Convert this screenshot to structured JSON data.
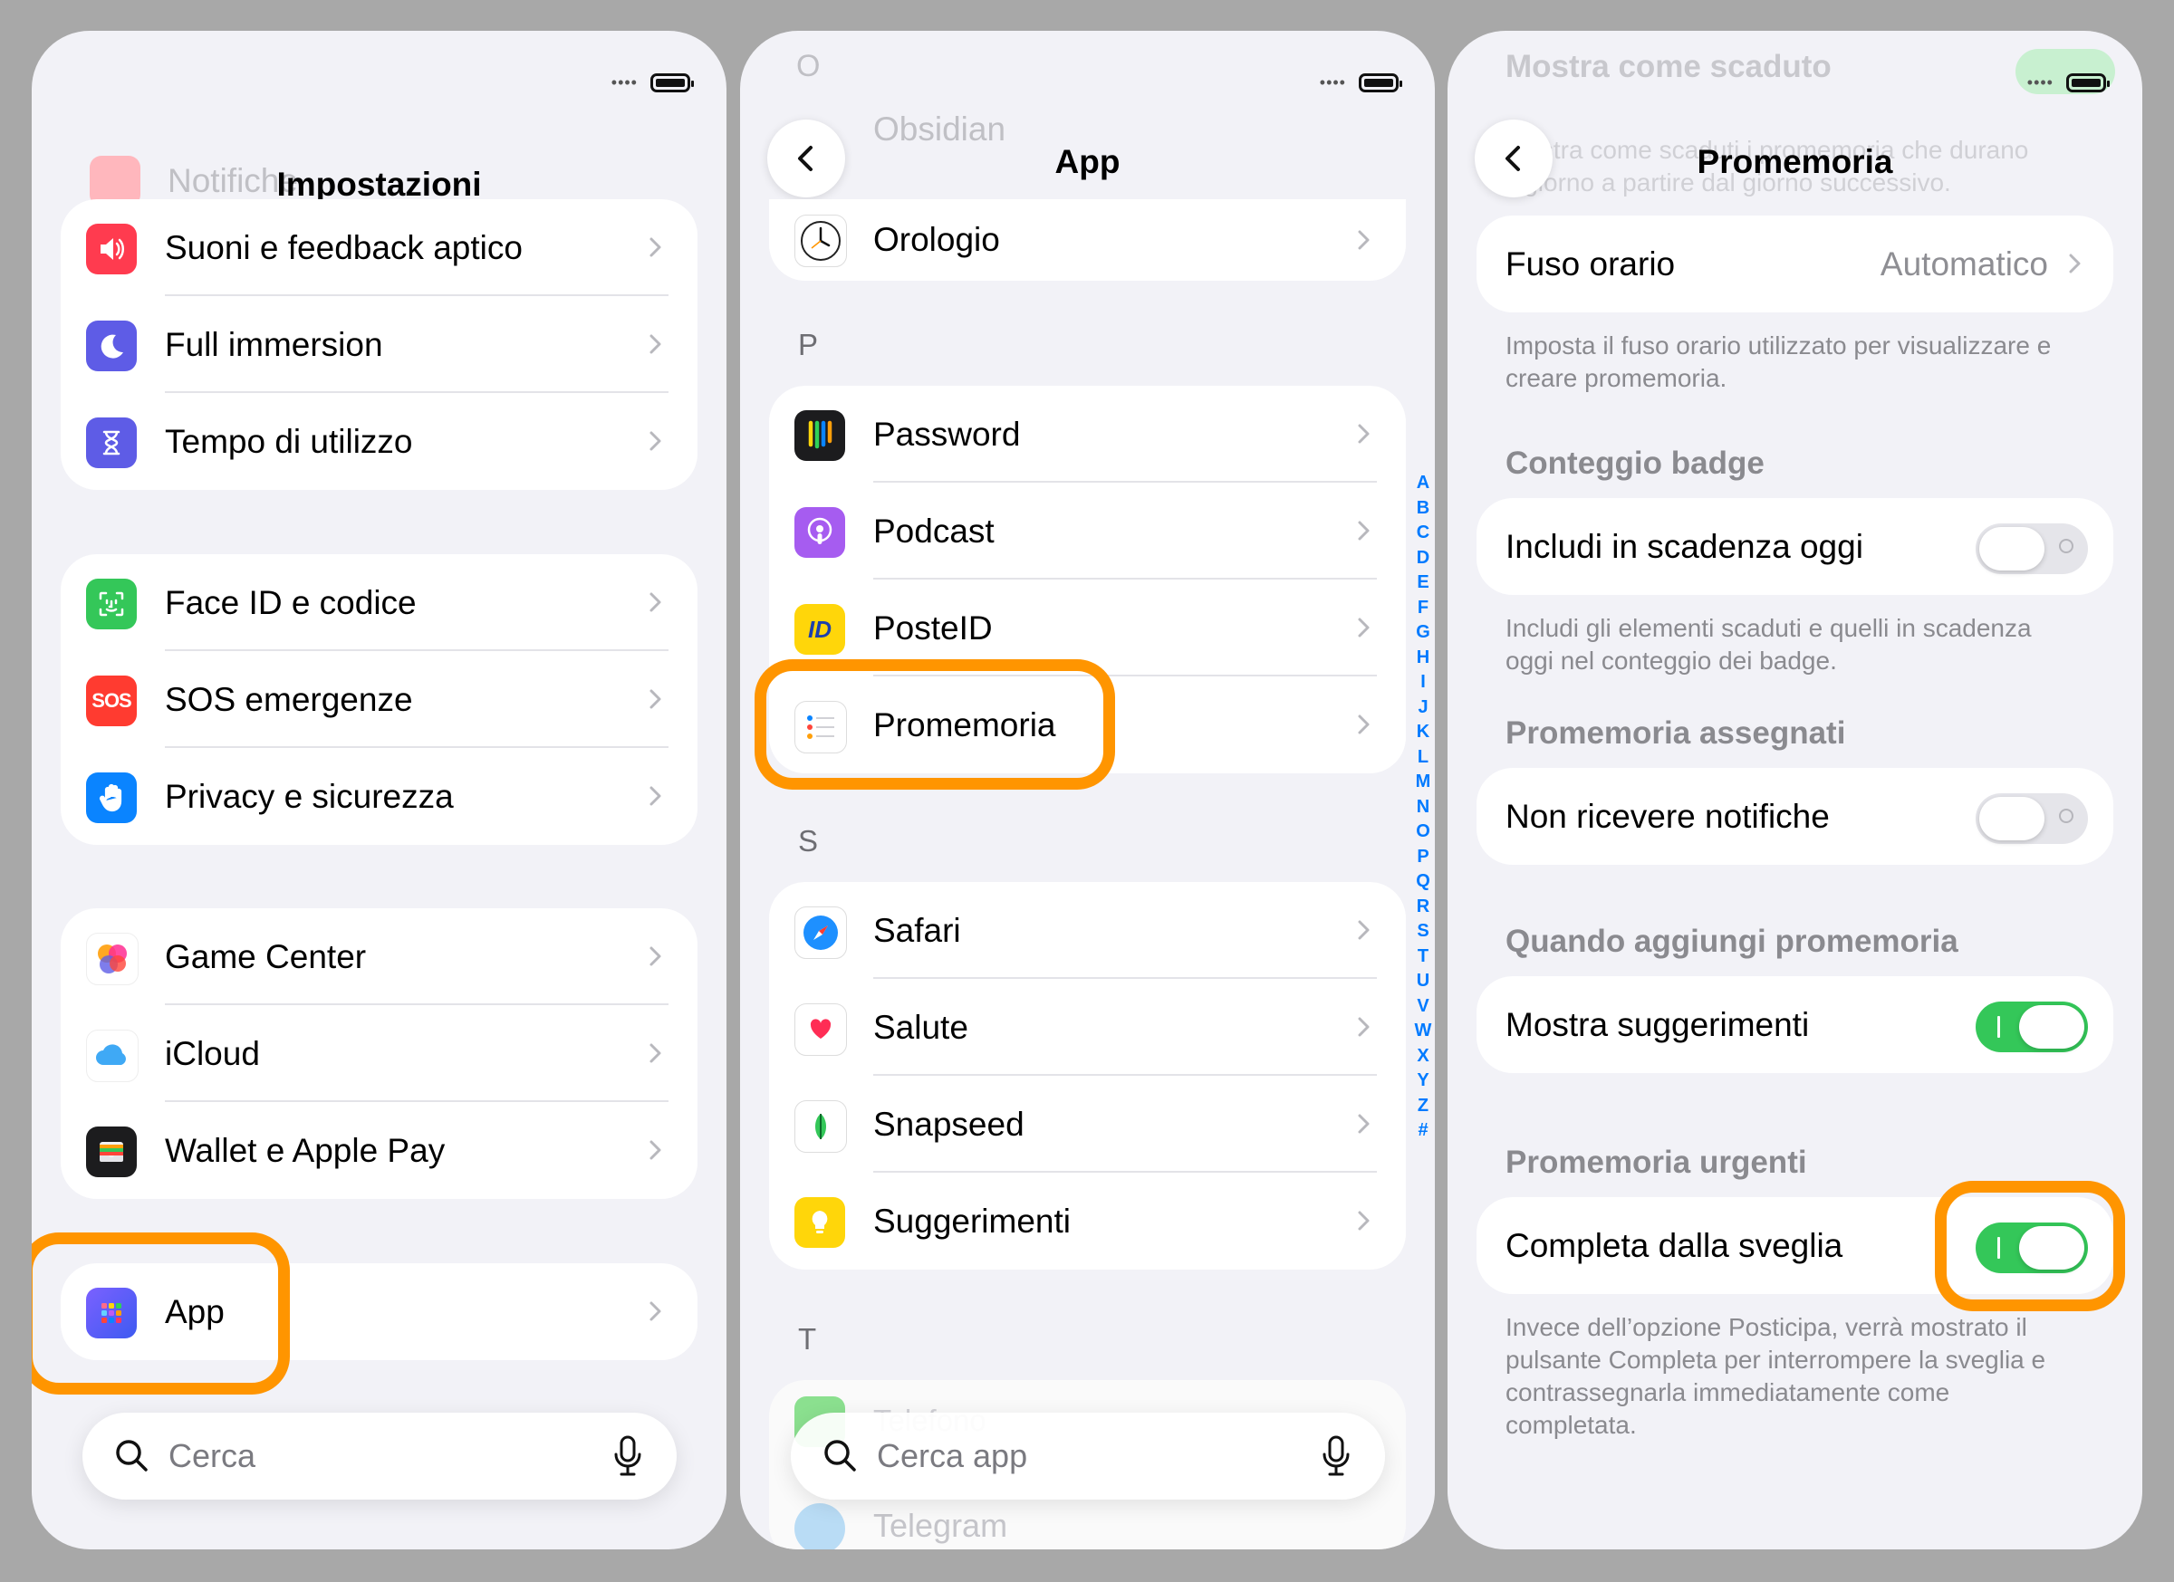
{
  "accent_color": "#ff9500",
  "panel1": {
    "title": "Impostazioni",
    "ghost_text": "Notifiche",
    "group1": [
      {
        "label": "Suoni e feedback aptico",
        "icon": "speaker-icon",
        "color": "#ff3b4f"
      },
      {
        "label": "Full immersion",
        "icon": "moon-icon",
        "color": "#5e5ce6"
      },
      {
        "label": "Tempo di utilizzo",
        "icon": "hourglass-icon",
        "color": "#5e5ce6"
      }
    ],
    "group2": [
      {
        "label": "Face ID e codice",
        "icon": "face-id-icon",
        "color": "#34c759"
      },
      {
        "label": "SOS emergenze",
        "icon": "sos-icon",
        "color": "#ff3b30",
        "badge_text": "SOS"
      },
      {
        "label": "Privacy e sicurezza",
        "icon": "hand-icon",
        "color": "#0a84ff"
      }
    ],
    "group3": [
      {
        "label": "Game Center",
        "icon": "game-center-icon",
        "color": "#ffffff"
      },
      {
        "label": "iCloud",
        "icon": "icloud-icon",
        "color": "#ffffff"
      },
      {
        "label": "Wallet e Apple Pay",
        "icon": "wallet-icon",
        "color": "#1c1c1e"
      }
    ],
    "group4": [
      {
        "label": "App",
        "icon": "app-grid-icon",
        "color": "#5e5ce6"
      }
    ],
    "search_placeholder": "Cerca"
  },
  "panel2": {
    "title": "App",
    "ghost_top": "O",
    "ghost_row": "Obsidian",
    "top_row": {
      "label": "Orologio",
      "icon": "clock-icon"
    },
    "sections": [
      {
        "letter": "P",
        "rows": [
          {
            "label": "Password",
            "icon": "password-keys-icon"
          },
          {
            "label": "Podcast",
            "icon": "podcast-icon"
          },
          {
            "label": "PosteID",
            "icon": "posteid-icon",
            "badge_text": "ID"
          },
          {
            "label": "Promemoria",
            "icon": "reminders-icon"
          }
        ]
      },
      {
        "letter": "S",
        "rows": [
          {
            "label": "Safari",
            "icon": "safari-icon"
          },
          {
            "label": "Salute",
            "icon": "health-heart-icon"
          },
          {
            "label": "Snapseed",
            "icon": "snapseed-leaf-icon"
          },
          {
            "label": "Suggerimenti",
            "icon": "tips-bulb-icon"
          }
        ]
      },
      {
        "letter": "T",
        "rows": [
          {
            "label": "Telefono",
            "icon": "phone-icon"
          },
          {
            "label": "Telegram",
            "icon": "telegram-icon"
          }
        ]
      }
    ],
    "index_letters": [
      "A",
      "B",
      "C",
      "D",
      "E",
      "F",
      "G",
      "H",
      "I",
      "J",
      "K",
      "L",
      "M",
      "N",
      "O",
      "P",
      "Q",
      "R",
      "S",
      "T",
      "U",
      "V",
      "W",
      "X",
      "Y",
      "Z",
      "#"
    ],
    "search_placeholder": "Cerca app"
  },
  "panel3": {
    "title": "Promemoria",
    "ghost_line1": "Mostra come scaduto",
    "ghost_line2": "Mostra come scaduti i promemoria che durano",
    "ghost_line3": "il giorno a partire dal giorno successivo.",
    "timezone": {
      "label": "Fuso orario",
      "value": "Automatico"
    },
    "timezone_footer": "Imposta il fuso orario utilizzato per visualizzare e creare promemoria.",
    "badge_header": "Conteggio badge",
    "badge_row": {
      "label": "Includi in scadenza oggi",
      "on": false
    },
    "badge_footer": "Includi gli elementi scaduti e quelli in scadenza oggi nel conteggio dei badge.",
    "assigned_header": "Promemoria assegnati",
    "assigned_row": {
      "label": "Non ricevere notifiche",
      "on": false
    },
    "adding_header": "Quando aggiungi promemoria",
    "adding_row": {
      "label": "Mostra suggerimenti",
      "on": true
    },
    "urgent_header": "Promemoria urgenti",
    "urgent_row": {
      "label": "Completa dalla sveglia",
      "on": true
    },
    "urgent_footer": "Invece dell’opzione Posticipa, verrà mostrato il pulsante Completa per interrompere la sveglia e contrassegnarla immediatamente come completata."
  }
}
